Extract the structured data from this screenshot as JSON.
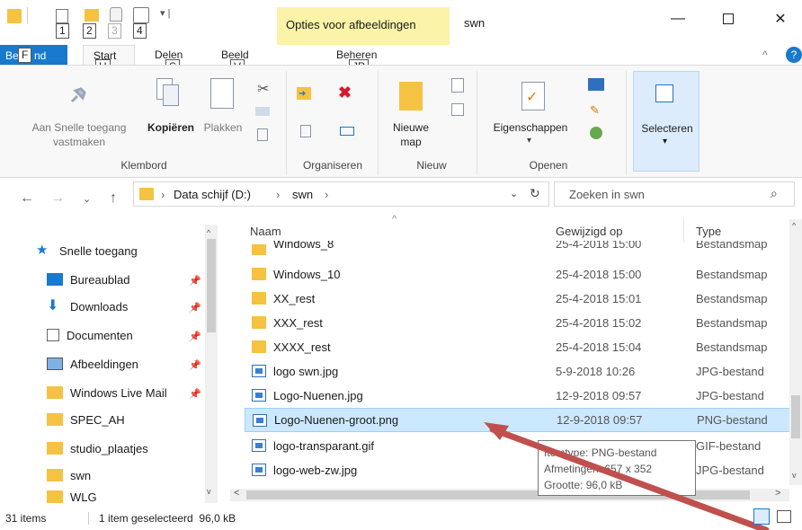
{
  "window": {
    "context_tab": "Opties voor afbeeldingen",
    "title": "swn",
    "minimize_icon": "minimize-icon",
    "maximize_icon": "maximize-icon",
    "close_icon": "close-icon"
  },
  "quick_access_keytips": [
    "1",
    "2",
    "3",
    "4"
  ],
  "tabs": {
    "file": "Bestand",
    "file_keytip": "F",
    "start": "Start",
    "start_keytip": "H",
    "share": "Delen",
    "share_keytip": "S",
    "view": "Beeld",
    "view_keytip": "V",
    "manage": "Beheren",
    "manage_keytip": "JP"
  },
  "ribbon": {
    "pin_label_1": "Aan Snelle toegang",
    "pin_label_2": "vastmaken",
    "copy": "Kopiëren",
    "paste": "Plakken",
    "clipboard_group": "Klembord",
    "organize_group": "Organiseren",
    "new_folder_1": "Nieuwe",
    "new_folder_2": "map",
    "new_group": "Nieuw",
    "properties": "Eigenschappen",
    "open_group": "Openen",
    "select": "Selecteren"
  },
  "address": {
    "path": [
      "Data schijf (D:)",
      "swn"
    ],
    "search_placeholder": "Zoeken in swn"
  },
  "nav": [
    {
      "label": "Snelle toegang",
      "icon": "star-icon"
    },
    {
      "label": "Bureaublad",
      "icon": "desktop-icon",
      "pinned": true
    },
    {
      "label": "Downloads",
      "icon": "download-icon",
      "pinned": true
    },
    {
      "label": "Documenten",
      "icon": "document-icon",
      "pinned": true
    },
    {
      "label": "Afbeeldingen",
      "icon": "pictures-icon",
      "pinned": true
    },
    {
      "label": "Windows Live Mail",
      "icon": "folder-icon",
      "pinned": true
    },
    {
      "label": "SPEC_AH",
      "icon": "folder-icon"
    },
    {
      "label": "studio_plaatjes",
      "icon": "folder-icon"
    },
    {
      "label": "swn",
      "icon": "folder-icon"
    },
    {
      "label": "WLG",
      "icon": "folder-icon"
    }
  ],
  "columns": {
    "name": "Naam",
    "date": "Gewijzigd op",
    "type": "Type"
  },
  "files": [
    {
      "name": "Windows_8",
      "date": "25-4-2018 15:00",
      "type": "Bestandsmap",
      "kind": "folder"
    },
    {
      "name": "Windows_10",
      "date": "25-4-2018 15:00",
      "type": "Bestandsmap",
      "kind": "folder"
    },
    {
      "name": "XX_rest",
      "date": "25-4-2018 15:01",
      "type": "Bestandsmap",
      "kind": "folder"
    },
    {
      "name": "XXX_rest",
      "date": "25-4-2018 15:02",
      "type": "Bestandsmap",
      "kind": "folder"
    },
    {
      "name": "XXXX_rest",
      "date": "25-4-2018 15:04",
      "type": "Bestandsmap",
      "kind": "folder"
    },
    {
      "name": "logo swn.jpg",
      "date": "5-9-2018 10:26",
      "type": "JPG-bestand",
      "kind": "image"
    },
    {
      "name": "Logo-Nuenen.jpg",
      "date": "12-9-2018 09:57",
      "type": "JPG-bestand",
      "kind": "image"
    },
    {
      "name": "Logo-Nuenen-groot.png",
      "date": "12-9-2018 09:57",
      "type": "PNG-bestand",
      "kind": "image",
      "selected": true
    },
    {
      "name": "logo-transparant.gif",
      "date": "",
      "type": "GIF-bestand",
      "kind": "image"
    },
    {
      "name": "logo-web-zw.jpg",
      "date": "",
      "type": "JPG-bestand",
      "kind": "image"
    }
  ],
  "tooltip": {
    "line1": "Itemtype: PNG-bestand",
    "line2": "Afmetingen: 657 x 352",
    "line3": "Grootte: 96,0 kB"
  },
  "status": {
    "count": "31 items",
    "selection": "1 item geselecteerd  96,0 kB"
  },
  "colors": {
    "accent": "#1979ca",
    "selection": "#cce8ff",
    "context_tab": "#fbf3a8",
    "annotation_arrow": "#c0504d"
  }
}
